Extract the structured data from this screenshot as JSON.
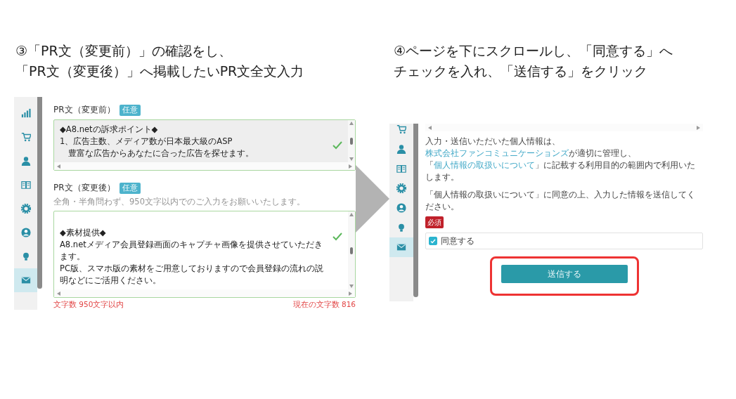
{
  "steps": [
    {
      "caption": [
        "③「PR文（変更前）」の確認をし、",
        "「PR文（変更後）」へ掲載したいPR文全文入力"
      ]
    },
    {
      "caption": [
        "④ページを下にスクロールし、「同意する」へ",
        "チェックを入れ、「送信する」をクリック"
      ]
    }
  ],
  "left_screen": {
    "sidebar": [
      {
        "selected": false
      },
      {
        "selected": false
      },
      {
        "selected": false
      },
      {
        "selected": false
      },
      {
        "selected": false
      },
      {
        "selected": false
      },
      {
        "selected": false
      },
      {
        "selected": true
      }
    ],
    "before": {
      "label": "PR文（変更前）",
      "badge": "任意",
      "value": "◆A8.netの訴求ポイント◆\n1、広告主数、メディア数が日本最大級のASP\n　豊富な広告からあなたに合った広告を探せます。",
      "valid": true,
      "readonly": true
    },
    "after": {
      "label": "PR文（変更後）",
      "badge": "任意",
      "hint": "全角・半角問わず、950文字以内でのご入力をお願いいたします。",
      "value": "\n◆素材提供◆\nA8.netメディア会員登録画面のキャプチャ画像を提供させていただきます。\nPC版、スマホ版の素材をご用意しておりますので会員登録の流れの説明などにご活用ください。",
      "valid": true,
      "readonly": false,
      "limit": "文字数 950文字以内",
      "count": "現在の文字数 816"
    }
  },
  "right_screen": {
    "sidebar": [
      {
        "selected": false
      },
      {
        "selected": false
      },
      {
        "selected": false
      },
      {
        "selected": false
      },
      {
        "selected": false
      },
      {
        "selected": false
      },
      {
        "selected": true
      }
    ],
    "notice": [
      {
        "text": "入力・送信いただいた個人情報は、",
        "link": false
      },
      {
        "text": "株式会社ファンコミュニケーションズ",
        "link": true
      },
      {
        "text": "が適切に管理し、「",
        "link": false
      },
      {
        "text": "個人情報の取扱いについて",
        "link": true
      },
      {
        "text": "」に記載する利用目的の範囲内で利用いたします。",
        "link": false
      }
    ],
    "prompt": "「個人情報の取扱いについて」に同意の上、入力した情報を送信してください。",
    "required": "必須",
    "agree": {
      "label": "同意する",
      "checked": true
    },
    "submit": "送信する"
  }
}
